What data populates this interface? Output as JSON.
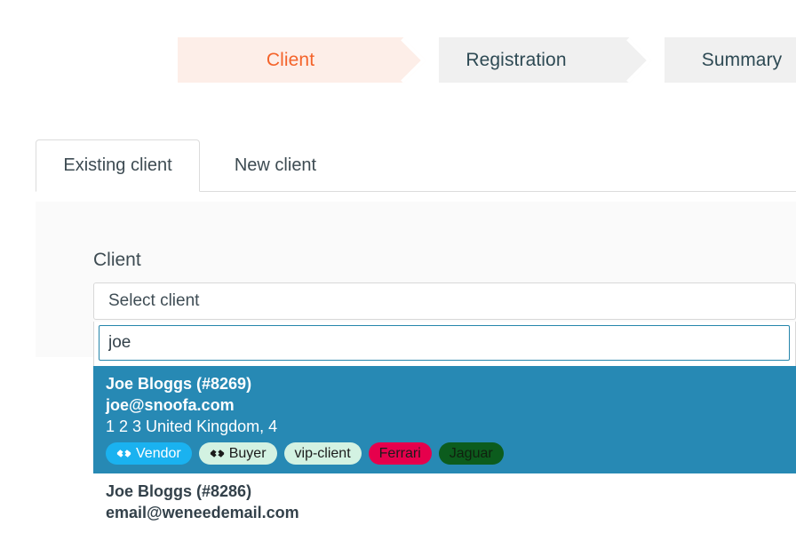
{
  "wizard": {
    "steps": [
      {
        "label": "Client",
        "state": "active"
      },
      {
        "label": "Registration",
        "state": "upcoming"
      },
      {
        "label": "Summary",
        "state": "upcoming"
      }
    ],
    "active_color": "#f4632a",
    "active_bg": "#fdeee8",
    "upcoming_bg": "#f0f0f0",
    "upcoming_color": "#2e4a54"
  },
  "tabs": [
    {
      "label": "Existing client",
      "active": true
    },
    {
      "label": "New client",
      "active": false
    }
  ],
  "form": {
    "client_label": "Client",
    "select_placeholder": "Select client",
    "search_value": "joe",
    "search_placeholder": "",
    "focus_border_color": "#2585ab"
  },
  "dropdown": {
    "highlight_bg": "#2789b4",
    "options": [
      {
        "name": "Joe Bloggs (#8269)",
        "email": "joe@snoofa.com",
        "address": "1 2 3 United Kingdom, 4",
        "highlighted": true,
        "badges": [
          {
            "label": "Vendor",
            "icon": "handshake-icon",
            "bg": "#1ab2f0",
            "fg": "#ffffff"
          },
          {
            "label": "Buyer",
            "icon": "handshake-icon",
            "bg": "#d3f2e2",
            "fg": "#1b1b1b"
          },
          {
            "label": "vip-client",
            "icon": "",
            "bg": "#d3f2e2",
            "fg": "#1b1b1b"
          },
          {
            "label": "Ferrari",
            "icon": "",
            "bg": "#e6004c",
            "fg": "#1b1b1b"
          },
          {
            "label": "Jaguar",
            "icon": "",
            "bg": "#0c5c1d",
            "fg": "#10210f"
          }
        ]
      },
      {
        "name": "Joe Bloggs (#8286)",
        "email": "email@weneedemail.com",
        "address": "",
        "highlighted": false,
        "badges": []
      }
    ]
  }
}
